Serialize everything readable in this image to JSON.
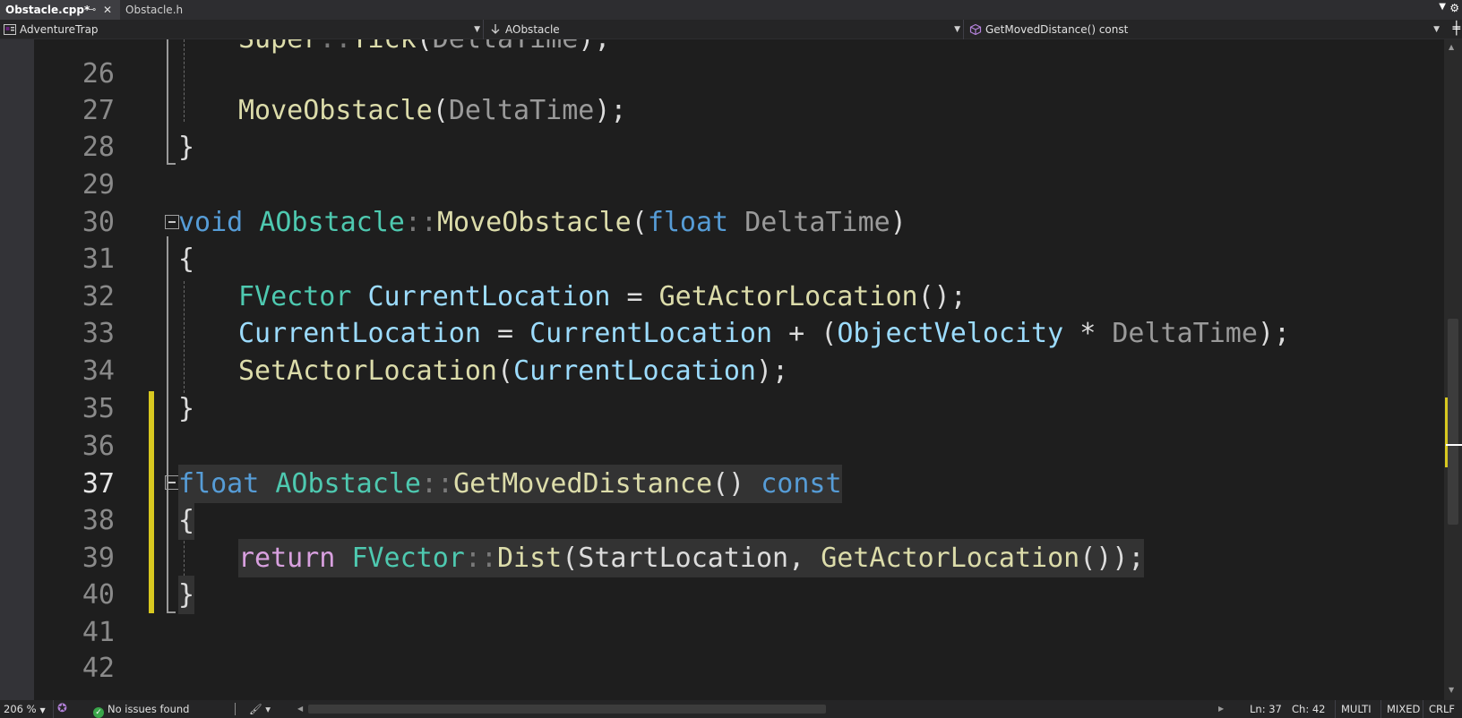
{
  "tabs": [
    {
      "title": "Obstacle.cpp*",
      "active": true
    },
    {
      "title": "Obstacle.h",
      "active": false
    }
  ],
  "tab_icons": {
    "pin": "pin-icon",
    "close": "close-icon",
    "dropdown": "chevron-down-icon",
    "gear": "gear-icon"
  },
  "navbar": {
    "project": "AdventureTrap",
    "class_scope": "AObstacle",
    "member": "GetMovedDistance() const",
    "split_icon": "split-window-icon"
  },
  "editor": {
    "current_line": 37,
    "lines": [
      {
        "number": "",
        "text": "Super::Tick(DeltaTime);"
      },
      {
        "number": "26",
        "text": ""
      },
      {
        "number": "27",
        "text": "MoveObstacle(DeltaTime);"
      },
      {
        "number": "28",
        "text": "}"
      },
      {
        "number": "29",
        "text": ""
      },
      {
        "number": "30",
        "text": "void AObstacle::MoveObstacle(float DeltaTime)"
      },
      {
        "number": "31",
        "text": "{"
      },
      {
        "number": "32",
        "text": "FVector CurrentLocation = GetActorLocation();"
      },
      {
        "number": "33",
        "text": "CurrentLocation = CurrentLocation + (ObjectVelocity * DeltaTime);"
      },
      {
        "number": "34",
        "text": "SetActorLocation(CurrentLocation);"
      },
      {
        "number": "35",
        "text": "}"
      },
      {
        "number": "36",
        "text": ""
      },
      {
        "number": "37",
        "text": "float AObstacle::GetMovedDistance() const"
      },
      {
        "number": "38",
        "text": "{"
      },
      {
        "number": "39",
        "text": "return FVector::Dist(StartLocation, GetActorLocation());"
      },
      {
        "number": "40",
        "text": "}"
      },
      {
        "number": "41",
        "text": ""
      },
      {
        "number": "42",
        "text": ""
      }
    ]
  },
  "colors": {
    "keyword": "#569cd6",
    "control_keyword": "#d8a0df",
    "type": "#4ec9b0",
    "function": "#dcdcaa",
    "variable": "#9cdcfe",
    "parameter": "#9a9a9a",
    "change_marker": "#d8c820",
    "background": "#1e1e1e"
  },
  "statusbar": {
    "zoom": "206 %",
    "issues": "No issues found",
    "line": "Ln: 37",
    "column": "Ch: 42",
    "tabs_mode": "MULTI",
    "indent_mode": "MIXED",
    "line_endings": "CRLF"
  }
}
